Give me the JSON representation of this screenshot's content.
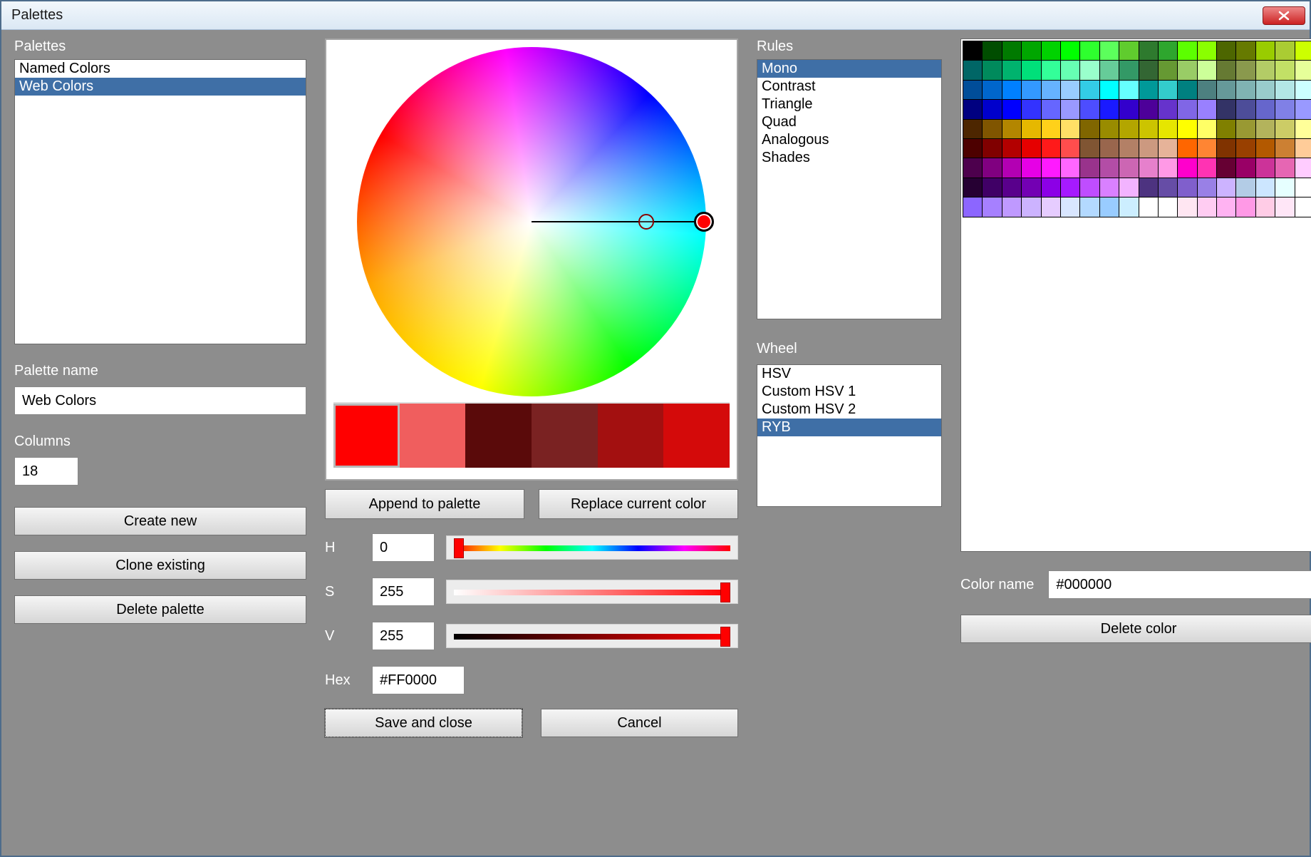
{
  "window": {
    "title": "Palettes"
  },
  "sections": {
    "palettes": "Palettes",
    "palette_name": "Palette name",
    "columns": "Columns",
    "rules": "Rules",
    "wheel": "Wheel",
    "color_name": "Color name"
  },
  "palettes_list": {
    "items": [
      "Named Colors",
      "Web Colors"
    ],
    "selected_index": 1
  },
  "palette_name_value": "Web Colors",
  "columns_value": "18",
  "buttons": {
    "create_new": "Create new",
    "clone_existing": "Clone existing",
    "delete_palette": "Delete palette",
    "append_to_palette": "Append to palette",
    "replace_current_color": "Replace current color",
    "save_and_close": "Save and close",
    "cancel": "Cancel",
    "delete_color": "Delete color"
  },
  "swatches": [
    "#ff0000",
    "#f05e5e",
    "#5a0a0a",
    "#7a2222",
    "#a31010",
    "#d40a0a"
  ],
  "hsv": {
    "h_label": "H",
    "h_value": "0",
    "s_label": "S",
    "s_value": "255",
    "v_label": "V",
    "v_value": "255",
    "hex_label": "Hex",
    "hex_value": "#FF0000"
  },
  "rules_list": {
    "items": [
      "Mono",
      "Contrast",
      "Triangle",
      "Quad",
      "Analogous",
      "Shades"
    ],
    "selected_index": 0
  },
  "wheel_list": {
    "items": [
      "HSV",
      "Custom HSV 1",
      "Custom HSV 2",
      "RYB"
    ],
    "selected_index": 3
  },
  "color_name_value": "#000000",
  "grid_colors": [
    "#000000",
    "#004d00",
    "#007a00",
    "#00a600",
    "#00d200",
    "#00ff00",
    "#2eff2e",
    "#5cff5c",
    "#60cc2e",
    "#2e7a2e",
    "#2ea62e",
    "#5cff00",
    "#8aff00",
    "#4d6600",
    "#667a00",
    "#99cc00",
    "#aacc33",
    "#ccff00",
    "#006666",
    "#008a5c",
    "#00b36e",
    "#00e07a",
    "#33ff99",
    "#66ffb3",
    "#99ffcc",
    "#66cc99",
    "#339966",
    "#336633",
    "#669933",
    "#99cc66",
    "#ccff99",
    "#667a33",
    "#8a994d",
    "#b3cc66",
    "#c2e066",
    "#e6ff99",
    "#004d99",
    "#0066cc",
    "#0080ff",
    "#3399ff",
    "#66b3ff",
    "#99ccff",
    "#33cce6",
    "#00ffff",
    "#66ffff",
    "#009999",
    "#33cccc",
    "#008080",
    "#4d8080",
    "#669999",
    "#80b3b3",
    "#99cccc",
    "#b3e6e6",
    "#ccffff",
    "#000080",
    "#0000cc",
    "#0000ff",
    "#3333ff",
    "#6666ff",
    "#9999ff",
    "#4d4dff",
    "#1a1aff",
    "#3300cc",
    "#4d0099",
    "#6633cc",
    "#8066e6",
    "#9980ff",
    "#333366",
    "#4d4d99",
    "#6666cc",
    "#8080e6",
    "#9999ff",
    "#4d2600",
    "#805500",
    "#b38600",
    "#e6b800",
    "#ffd11a",
    "#ffe066",
    "#806600",
    "#998c00",
    "#b3a600",
    "#ccc400",
    "#e6e600",
    "#ffff00",
    "#ffff66",
    "#808000",
    "#999933",
    "#b3b35c",
    "#cccc66",
    "#ffff99",
    "#4d0000",
    "#800000",
    "#b30000",
    "#e60000",
    "#ff1a1a",
    "#ff4d4d",
    "#805533",
    "#99664d",
    "#b38066",
    "#cc9980",
    "#e6b399",
    "#ff6600",
    "#ff8533",
    "#803300",
    "#994000",
    "#b35900",
    "#cc8033",
    "#ffcc99",
    "#4d004d",
    "#800080",
    "#b300b3",
    "#e600e6",
    "#ff1aff",
    "#ff66ff",
    "#99338c",
    "#b34da6",
    "#cc66b3",
    "#e680cc",
    "#ff99e6",
    "#ff00cc",
    "#ff33b3",
    "#660033",
    "#990066",
    "#cc3399",
    "#e666b3",
    "#ffccff",
    "#260033",
    "#400066",
    "#59008c",
    "#7300b3",
    "#8c00e6",
    "#a61aff",
    "#bf4dff",
    "#d980ff",
    "#f2b3ff",
    "#4d3380",
    "#664da6",
    "#805fcc",
    "#9980e6",
    "#ccb3ff",
    "#b3cce6",
    "#cce6ff",
    "#e6ffff",
    "#ffffff",
    "#8c66ff",
    "#a680ff",
    "#bf99ff",
    "#ccb3ff",
    "#e6ccff",
    "#d9e6ff",
    "#b3d9ff",
    "#99ccff",
    "#cceeff",
    "#ffffff",
    "#ffffff",
    "#ffe6f2",
    "#ffccf2",
    "#ffb3f2",
    "#ff99e6",
    "#ffcce6",
    "#ffe6f7",
    "#ffffff"
  ]
}
